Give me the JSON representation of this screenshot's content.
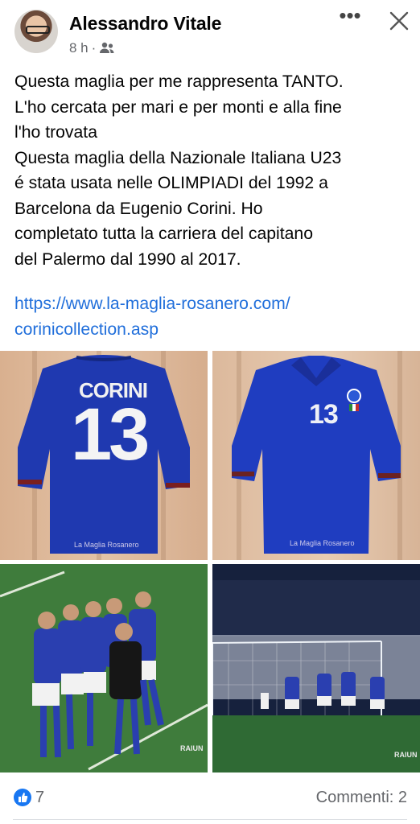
{
  "post": {
    "author": "Alessandro Vitale",
    "time": "8 h",
    "separator": "·",
    "body": "Questa maglia per me rappresenta TANTO.\nL'ho cercata per mari e per monti e alla fine\nl'ho trovata\nQuesta maglia della Nazionale Italiana U23\né stata usata nelle OLIMPIADI del 1992 a\nBarcelona da Eugenio Corini. Ho\ncompletato tutta la carriera del capitano\ndel Palermo dal 1990 al 2017.",
    "link": "https://www.la-maglia-rosanero.com/\ncorinicollection.asp"
  },
  "photos": {
    "jersey_back_name": "CORINI",
    "jersey_back_number": "13",
    "jersey_front_number": "13",
    "watermark": "La Maglia Rosanero",
    "broadcaster": "RAIUN"
  },
  "icons": {
    "audience": "friends-icon",
    "more": "more-icon",
    "close": "close-icon",
    "like": "like-icon"
  },
  "colors": {
    "link": "#216fdb",
    "like": "#1877f2",
    "jersey": "#1f39b0"
  },
  "footer": {
    "likes": "7",
    "comments": "Commenti: 2"
  }
}
